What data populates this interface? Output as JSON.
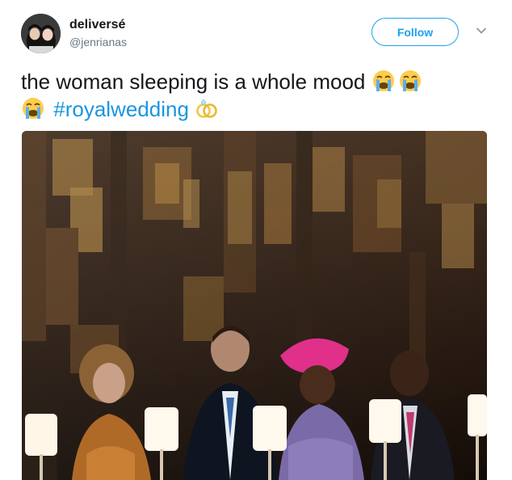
{
  "user": {
    "display_name": "deliversé",
    "handle": "@jenrianas",
    "avatar_icon": "profile-photo-avatar"
  },
  "follow_button": {
    "label": "Follow",
    "color": "#1da1f2"
  },
  "menu_icon": "chevron-down-icon",
  "tweet": {
    "text_line1": "the woman sleeping is a whole mood",
    "hashtag": "#royalwedding",
    "emojis": [
      "loudly-crying-face-icon",
      "loudly-crying-face-icon",
      "loudly-crying-face-icon",
      "rings-icon"
    ]
  },
  "media": {
    "type": "photo",
    "alt_icon": "wedding-guests-photo"
  },
  "colors": {
    "link": "#1b95e0",
    "text": "#14171a",
    "secondary": "#657786"
  }
}
